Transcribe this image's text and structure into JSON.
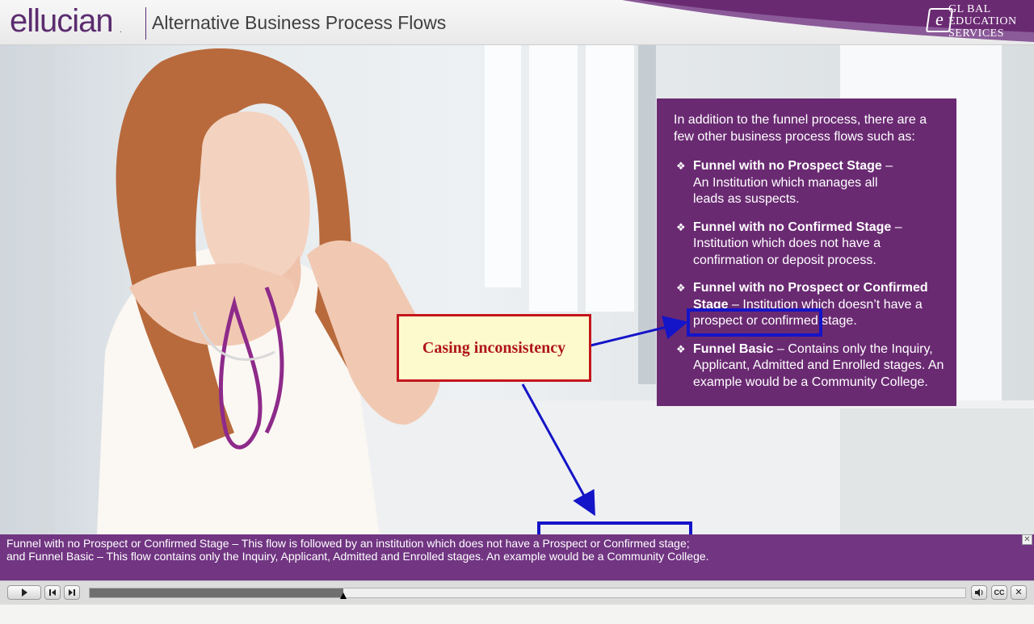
{
  "header": {
    "logo_text": "ellucian",
    "logo_mark": ".",
    "course_title": "Alternative Business Process Flows",
    "ges_mark": "e",
    "ges_lines": [
      "GL BAL",
      "EDUCATION",
      "SERVICES"
    ]
  },
  "info_panel": {
    "intro": "In addition to the funnel process, there are a few other business process flows such as:",
    "items": [
      {
        "title": "Funnel with no Prospect Stage",
        "sep": " –",
        "desc": "An Institution which manages all leads as suspects."
      },
      {
        "title": "Funnel with no Confirmed Stage",
        "sep": " –",
        "desc": "Institution which does not have a confirmation or deposit process."
      },
      {
        "title": "Funnel with no Prospect or Confirmed Stage",
        "sep": " –",
        "desc": "Institution which doesn’t have a prospect or confirmed stage."
      },
      {
        "title": "Funnel Basic",
        "sep": " –",
        "desc": "Contains only the Inquiry, Applicant, Admitted and Enrolled stages. An example would be a Community College."
      }
    ],
    "bullet": "❖"
  },
  "annotation": {
    "label": "Casing inconsistency",
    "colors": {
      "box_border": "#c4161c",
      "box_fill": "#fdfbcd",
      "arrow": "#1414c8"
    }
  },
  "caption": {
    "line1": "Funnel with no Prospect or Confirmed Stage – This flow is followed by an institution which does not have a Prospect or Confirmed stage;",
    "line2": "and Funnel Basic – This flow contains only the Inquiry, Applicant, Admitted and Enrolled stages. An example would be a Community College.",
    "close": "✕"
  },
  "player": {
    "progress": 0.29,
    "icons": [
      "play-icon",
      "previous-icon",
      "next-icon",
      "volume-icon",
      "cc-icon",
      "close-icon"
    ],
    "cc_label": "CC"
  },
  "colors": {
    "brand_purple": "#5b2c6f",
    "panel_purple": "#6a2a72",
    "caption_purple": "#713582"
  }
}
